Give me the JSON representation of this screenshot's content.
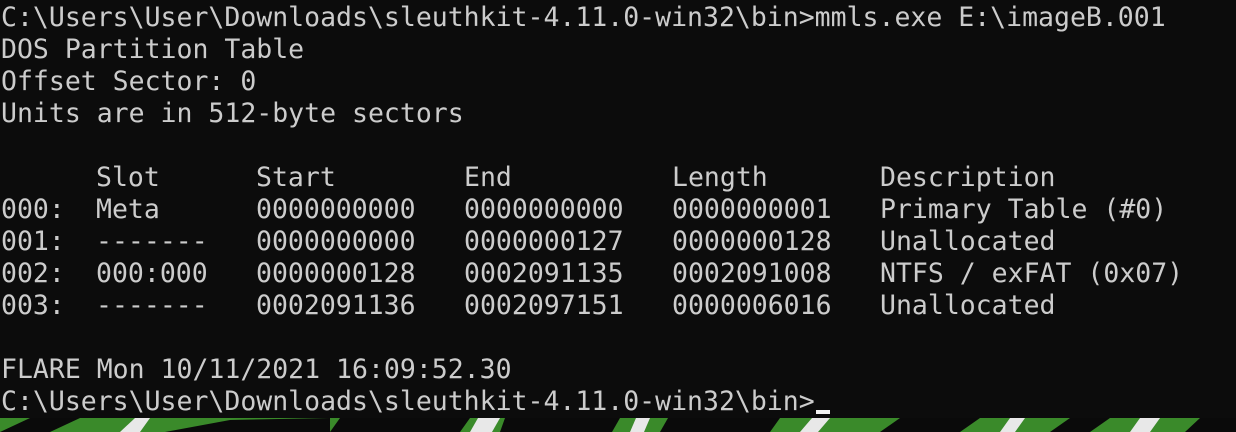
{
  "console": {
    "command_line": "C:\\Users\\User\\Downloads\\sleuthkit-4.11.0-win32\\bin>mmls.exe E:\\imageB.001",
    "header_lines": [
      "DOS Partition Table",
      "Offset Sector: 0",
      "Units are in 512-byte sectors"
    ],
    "table": {
      "columns": [
        "Slot",
        "Start",
        "End",
        "Length",
        "Description"
      ],
      "rows": [
        {
          "index": "000:",
          "slot": "Meta",
          "start": "0000000000",
          "end": "0000000000",
          "length": "0000000001",
          "description": "Primary Table (#0)"
        },
        {
          "index": "001:",
          "slot": "-------",
          "start": "0000000000",
          "end": "0000000127",
          "length": "0000000128",
          "description": "Unallocated"
        },
        {
          "index": "002:",
          "slot": "000:000",
          "start": "0000000128",
          "end": "0002091135",
          "length": "0002091008",
          "description": "NTFS / exFAT (0x07)"
        },
        {
          "index": "003:",
          "slot": "-------",
          "start": "0002091136",
          "end": "0002097151",
          "length": "0000006016",
          "description": "Unallocated"
        }
      ]
    },
    "timestamp_line": "FLARE Mon 10/11/2021 16:09:52.30",
    "prompt": "C:\\Users\\User\\Downloads\\sleuthkit-4.11.0-win32\\bin>"
  },
  "colors": {
    "background": "#0c0c0c",
    "foreground": "#cccccc",
    "cursor": "#f2f2f2",
    "wallpaper_green": "#3a8a2a"
  }
}
